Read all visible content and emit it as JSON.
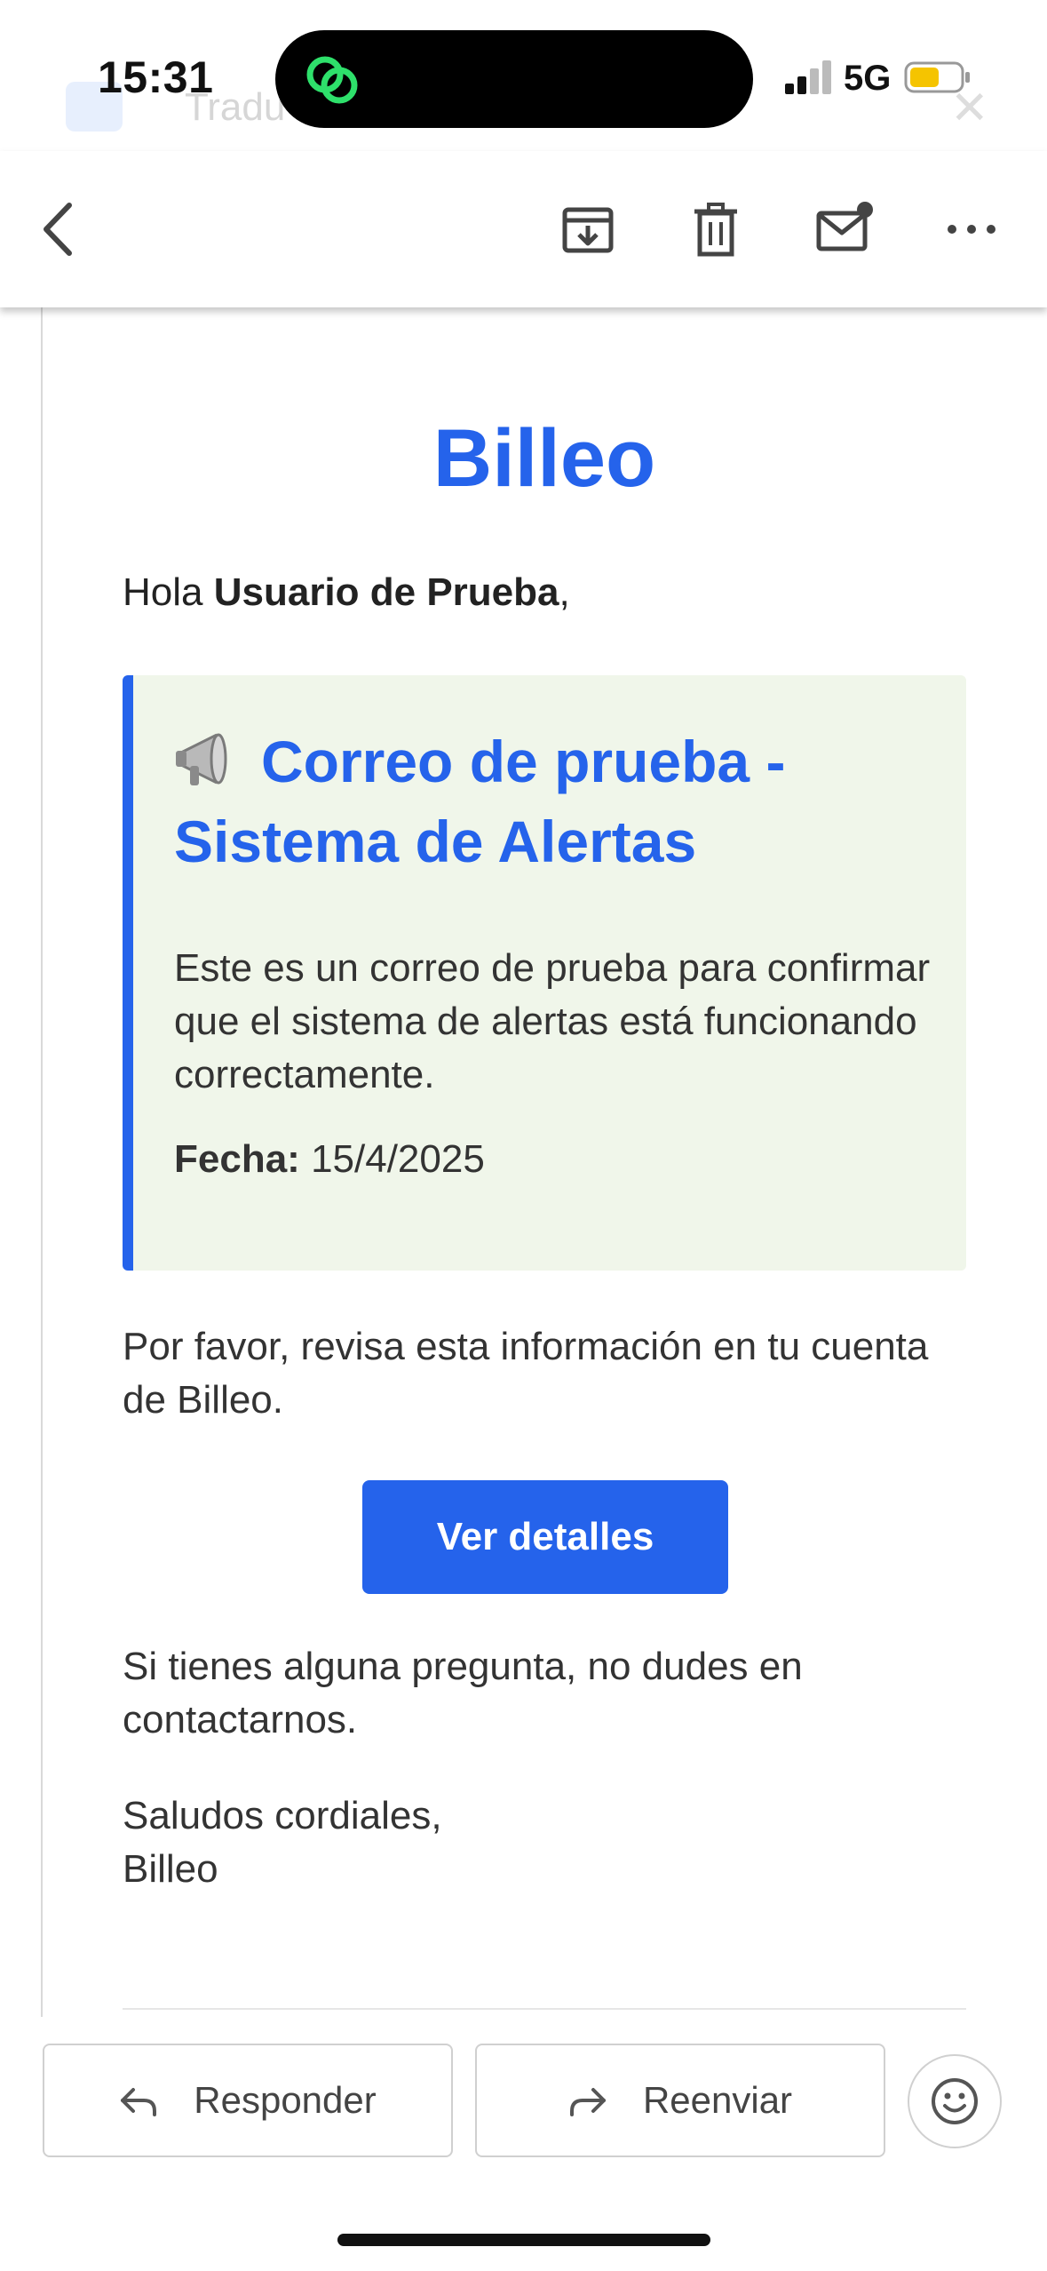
{
  "status_bar": {
    "time": "15:31",
    "network": "5G",
    "ghost_app_text": "Tradu"
  },
  "toolbar": {
    "back_icon": "chevron-left-icon",
    "archive_icon": "archive-icon",
    "delete_icon": "trash-icon",
    "mark_unread_icon": "mail-unread-icon",
    "more_icon": "more-horizontal-icon"
  },
  "email": {
    "brand": "Billeo",
    "greeting_prefix": "Hola ",
    "greeting_name": "Usuario de Prueba",
    "greeting_suffix": ",",
    "alert": {
      "title": "Correo de prueba - Sistema de Alertas",
      "body": "Este es un correo de prueba para confirmar que el sistema de alertas está funcionando correctamente.",
      "date_label": "Fecha:",
      "date_value": "15/4/2025"
    },
    "paragraph_review": "Por favor, revisa esta información en tu cuenta de Billeo.",
    "cta_label": "Ver detalles",
    "paragraph_questions": "Si tienes alguna pregunta, no dudes en contactarnos.",
    "signoff": "Saludos cordiales,",
    "signature": "Billeo"
  },
  "actions": {
    "reply_label": "Responder",
    "forward_label": "Reenviar",
    "emoji_icon": "emoji-reaction-icon"
  },
  "colors": {
    "accent": "#2563eb",
    "alert_background": "#f0f6ea",
    "battery": "#f5c400",
    "island_icon": "#2ee06b"
  }
}
